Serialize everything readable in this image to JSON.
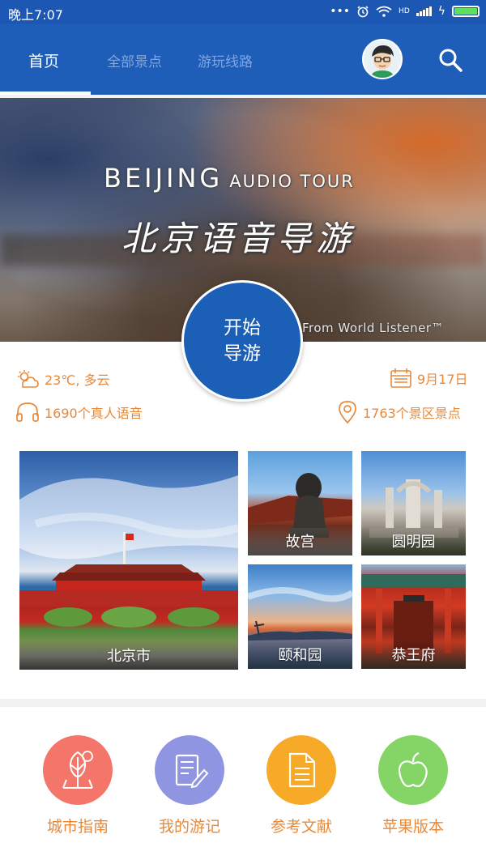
{
  "status_bar": {
    "time": "晚上7:07",
    "dots": "•••",
    "net": "HD"
  },
  "tabs": [
    {
      "label": "首页",
      "active": true
    },
    {
      "label": "全部景点",
      "active": false
    },
    {
      "label": "游玩线路",
      "active": false
    }
  ],
  "banner": {
    "title_en": "BEIJING",
    "title_en_sub": "AUDIO TOUR",
    "title_cn": "北京语音导游",
    "credit": "From World Listener™"
  },
  "start_button": {
    "line1": "开始",
    "line2": "导游"
  },
  "info": {
    "weather": "23℃, 多云",
    "date": "9月17日",
    "voice_count": "1690个真人语音",
    "spots_count": "1763个景区景点"
  },
  "tiles": [
    {
      "label": "北京市"
    },
    {
      "label": "故宫"
    },
    {
      "label": "圆明园"
    },
    {
      "label": "颐和园"
    },
    {
      "label": "恭王府"
    }
  ],
  "menu": [
    {
      "label": "城市指南",
      "color": "#f4766a"
    },
    {
      "label": "我的游记",
      "color": "#8f95e0"
    },
    {
      "label": "参考文献",
      "color": "#f7a928"
    },
    {
      "label": "苹果版本",
      "color": "#84d566"
    }
  ],
  "colors": {
    "primary": "#1e5eb8",
    "accent": "#e8893a"
  }
}
